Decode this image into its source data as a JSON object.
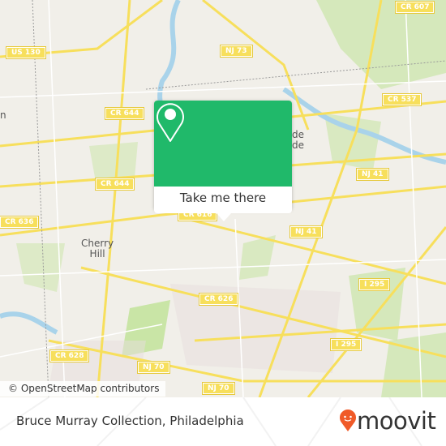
{
  "map": {
    "road_labels": [
      "CR 607",
      "US 130",
      "NJ 73",
      "CR 644",
      "CR 537",
      "CR 644",
      "NJ 41",
      "NJ 41",
      "CR 636",
      "CR 616",
      "I 295",
      "CR 626",
      "I 295",
      "CR 628",
      "NJ 70",
      "NJ 70"
    ],
    "place_labels": [
      "Cherry\nHill",
      "n",
      "de\nde"
    ],
    "attribution": "© OpenStreetMap contributors",
    "colors": {
      "land": "#f1efe9",
      "road": "#f7df5c",
      "park": "#c9e5a6",
      "water": "#a9d3ea",
      "accent": "#20b96a"
    }
  },
  "popup": {
    "icon": "map-pin-icon",
    "button_label": "Take me there"
  },
  "footer": {
    "title": "Bruce Murray Collection, Philadelphia",
    "logo_text": "moovit",
    "logo_icon": "moovit-pin-icon",
    "logo_color": "#f05a28"
  }
}
